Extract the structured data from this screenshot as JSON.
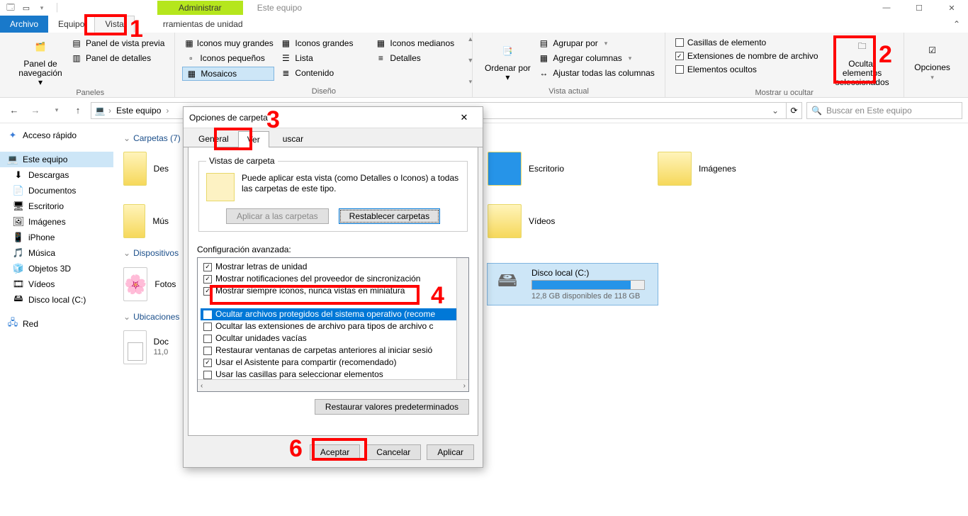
{
  "title": "Este equipo",
  "manage_tab": "Administrar",
  "tabs": {
    "file": "Archivo",
    "equipo": "Equipo",
    "vista": "Vista",
    "herramientas": "rramientas de unidad"
  },
  "ribbon": {
    "panes": {
      "nav_panel": "Panel de navegación",
      "preview": "Panel de vista previa",
      "details": "Panel de detalles",
      "label": "Paneles"
    },
    "layout": {
      "l1": "Iconos muy grandes",
      "l2": "Iconos grandes",
      "l3": "Iconos medianos",
      "l4": "Iconos pequeños",
      "l5": "Lista",
      "l6": "Detalles",
      "l7": "Mosaicos",
      "l8": "Contenido",
      "label": "Diseño"
    },
    "sort": {
      "big": "Ordenar por",
      "g1": "Agrupar por",
      "g2": "Agregar columnas",
      "g3": "Ajustar todas las columnas",
      "label": "Vista actual"
    },
    "show": {
      "c1": "Casillas de elemento",
      "c2": "Extensiones de nombre de archivo",
      "c3": "Elementos ocultos",
      "big": "Ocultar elementos seleccionados",
      "label": "Mostrar u ocultar"
    },
    "options": "Opciones"
  },
  "addr": {
    "root": "Este equipo",
    "search_placeholder": "Buscar en Este equipo"
  },
  "nav": {
    "quick": "Acceso rápido",
    "pc": "Este equipo",
    "items": [
      "Descargas",
      "Documentos",
      "Escritorio",
      "Imágenes",
      "iPhone",
      "Música",
      "Objetos 3D",
      "Vídeos",
      "Disco local (C:)"
    ],
    "net": "Red"
  },
  "content": {
    "folders_head": "Carpetas (7)",
    "col1": [
      {
        "name": "Des"
      },
      {
        "name": "Mús"
      }
    ],
    "col2": [
      {
        "name": "Escritorio"
      },
      {
        "name": "Vídeos"
      }
    ],
    "col3": [
      {
        "name": "Imágenes"
      }
    ],
    "devices_head": "Dispositivos",
    "photos": "Fotos",
    "locations_head": "Ubicaciones",
    "doc_name": "Doc",
    "doc_sub": "11,0",
    "disk": {
      "name": "Disco local (C:)",
      "free": "12,8 GB disponibles de 118 GB"
    }
  },
  "dialog": {
    "title": "Opciones de carpeta",
    "tabs": {
      "general": "General",
      "ver": "Ver",
      "buscar": "uscar"
    },
    "fv_legend": "Vistas de carpeta",
    "fv_text": "Puede aplicar esta vista (como Detalles o Iconos) a todas las carpetas de este tipo.",
    "apply_all": "Aplicar a las carpetas",
    "reset": "Restablecer carpetas",
    "adv_label": "Configuración avanzada:",
    "adv": [
      {
        "c": true,
        "t": "Mostrar letras de unidad"
      },
      {
        "c": true,
        "t": "Mostrar notificaciones del proveedor de sincronización"
      },
      {
        "c": true,
        "t": "Mostrar siempre iconos, nunca vistas en miniatura"
      },
      {
        "sel": true,
        "c": true,
        "t": "Ocultar archivos protegidos del sistema operativo (recome"
      },
      {
        "c": false,
        "t": "Ocultar las extensiones de archivo para tipos de archivo c"
      },
      {
        "c": false,
        "t": "Ocultar unidades vacías"
      },
      {
        "c": false,
        "t": "Restaurar ventanas de carpetas anteriores al iniciar sesió"
      },
      {
        "c": true,
        "t": "Usar el Asistente para compartir (recomendado)"
      },
      {
        "c": false,
        "t": "Usar las casillas para seleccionar elementos"
      }
    ],
    "restore": "Restaurar valores predeterminados",
    "ok": "Aceptar",
    "cancel": "Cancelar",
    "apply": "Aplicar"
  },
  "annotations": {
    "1": "1",
    "2": "2",
    "3": "3",
    "4": "4",
    "6": "6"
  }
}
